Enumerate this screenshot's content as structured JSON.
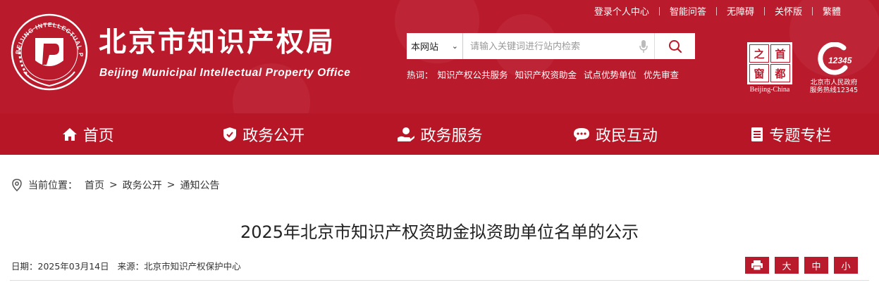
{
  "header": {
    "title": "北京市知识产权局",
    "subtitle": "Beijing Municipal Intellectual Property Office",
    "emblem_text": "BEIJING INTELLECTUAL PROPERTY",
    "top_links": [
      "登录个人中心",
      "智能问答",
      "无障碍",
      "关怀版",
      "繁體"
    ],
    "search": {
      "scope": "本网站",
      "placeholder": "请输入关键词进行站内检索"
    },
    "hot_label": "热词：",
    "hot_words": [
      "知识产权公共服务",
      "知识产权资助金",
      "试点优势单位",
      "优先审查"
    ],
    "capital_chars": [
      "之",
      "首",
      "窗",
      "都"
    ],
    "capital_caption": "Beijing-China",
    "hotline_number": "12345",
    "hotline_caption_1": "北京市人民政府",
    "hotline_caption_2": "服务热线12345"
  },
  "nav": {
    "items": [
      "首页",
      "政务公开",
      "政务服务",
      "政民互动",
      "专题专栏"
    ]
  },
  "breadcrumb": {
    "label": "当前位置：",
    "items": [
      "首页",
      "政务公开",
      "通知公告"
    ],
    "separator": ">"
  },
  "article": {
    "title": "2025年北京市知识产权资助金拟资助单位名单的公示",
    "date": "日期：2025年03月14日",
    "source": "来源：北京市知识产权保护中心",
    "font_large": "大",
    "font_medium": "中",
    "font_small": "小"
  },
  "colors": {
    "brand_red": "#ba1b2c",
    "nav_red": "#b71626"
  }
}
